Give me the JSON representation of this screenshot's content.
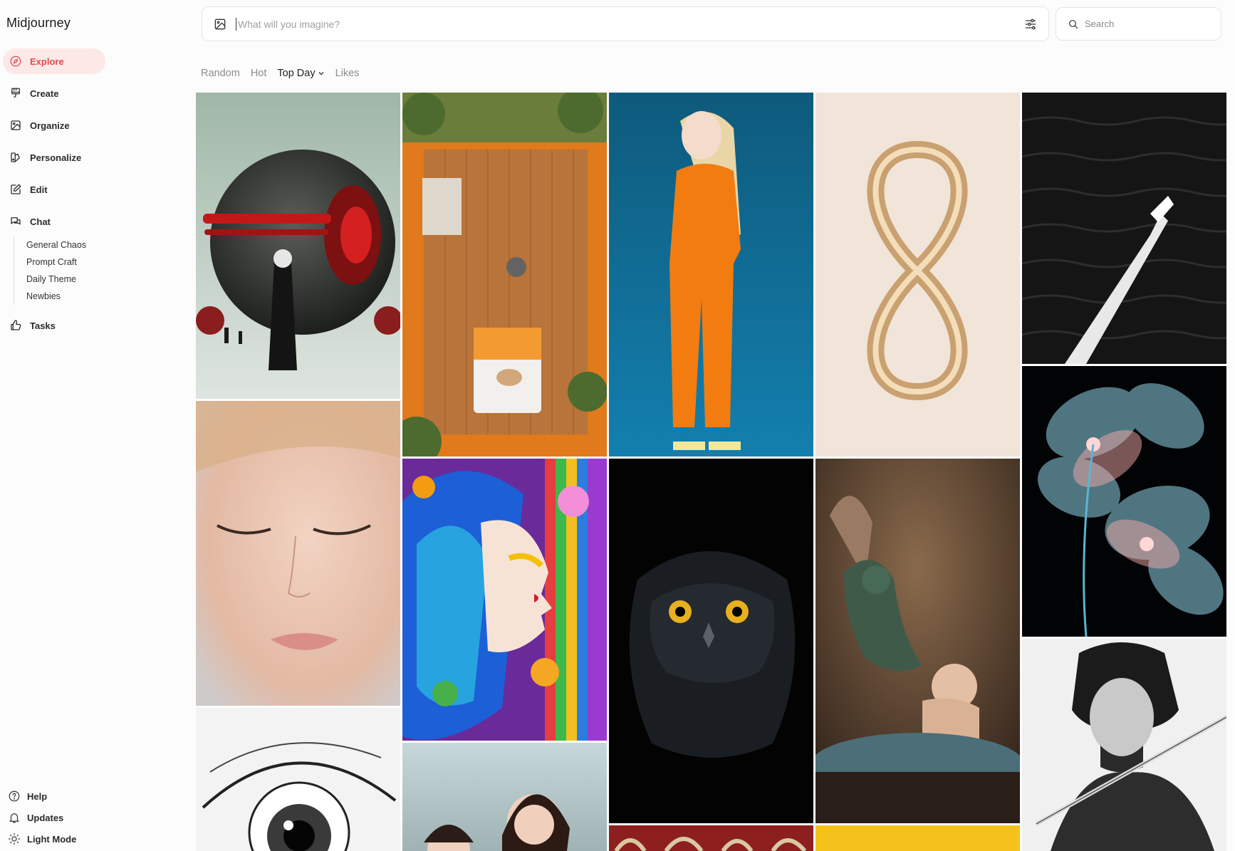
{
  "app": {
    "brand": "Midjourney"
  },
  "sidebar": {
    "items": [
      {
        "label": "Explore",
        "icon": "compass-icon",
        "active": true
      },
      {
        "label": "Create",
        "icon": "paintbrush-icon"
      },
      {
        "label": "Organize",
        "icon": "image-icon"
      },
      {
        "label": "Personalize",
        "icon": "palette-icon"
      },
      {
        "label": "Edit",
        "icon": "edit-icon"
      },
      {
        "label": "Chat",
        "icon": "chat-icon"
      }
    ],
    "chat_rooms": [
      "General Chaos",
      "Prompt Craft",
      "Daily Theme",
      "Newbies"
    ],
    "tasks": {
      "label": "Tasks",
      "icon": "thumbs-up-icon"
    },
    "bottom": [
      {
        "label": "Help",
        "icon": "help-icon"
      },
      {
        "label": "Updates",
        "icon": "bell-icon"
      },
      {
        "label": "Light Mode",
        "icon": "sun-icon"
      }
    ]
  },
  "imagine": {
    "placeholder": "What will you imagine?",
    "value": ""
  },
  "search": {
    "placeholder": "Search"
  },
  "tabs": [
    {
      "label": "Random",
      "active": false
    },
    {
      "label": "Hot",
      "active": false
    },
    {
      "label": "Top Day",
      "active": true
    },
    {
      "label": "Likes",
      "active": false
    }
  ],
  "colors": {
    "accent": "#e04c4c",
    "accent_bg": "#fde8e8"
  },
  "gallery": [
    {
      "name": "red-sphere-robot-image",
      "subject": "red sphere robot with old man"
    },
    {
      "name": "orange-room-topdown-image",
      "subject": "top-down orange room with cat"
    },
    {
      "name": "orange-suit-girl-image",
      "subject": "girl in orange suit"
    },
    {
      "name": "gold-infinity-image",
      "subject": "gold infinity loop"
    },
    {
      "name": "boat-wake-image",
      "subject": "boat on dark water"
    },
    {
      "name": "woman-face-closeup-image",
      "subject": "woman face closeup"
    },
    {
      "name": "mosaic-woman-image",
      "subject": "colorful mosaic woman profile"
    },
    {
      "name": "black-owl-image",
      "subject": "black owl portrait"
    },
    {
      "name": "baby-dragon-bath-image",
      "subject": "baby with dragon in bath"
    },
    {
      "name": "glass-flower-image",
      "subject": "translucent glass flowers"
    },
    {
      "name": "eye-sketch-image",
      "subject": "pencil sketch of eye"
    },
    {
      "name": "mother-daughter-image",
      "subject": "mother and daughter smiling"
    },
    {
      "name": "red-pattern-image",
      "subject": "red floral pattern"
    },
    {
      "name": "yellow-image",
      "subject": "yellow background"
    },
    {
      "name": "samurai-sketch-image",
      "subject": "samurai ink sketch"
    }
  ]
}
